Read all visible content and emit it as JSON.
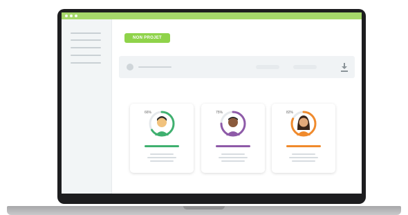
{
  "window": {
    "accent": "#a6d86a"
  },
  "main": {
    "new_project_label": "NON PROJET"
  },
  "icons": {
    "download": "download-icon"
  },
  "cards": [
    {
      "percent_label": "66%",
      "color": "#3fb06f",
      "progress": 0.66,
      "avatar": "man-green-shirt"
    },
    {
      "percent_label": "75%",
      "color": "#8e5aa8",
      "progress": 0.75,
      "avatar": "man-purple-shirt"
    },
    {
      "percent_label": "82%",
      "color": "#f08a2c",
      "progress": 0.82,
      "avatar": "woman-orange-shirt"
    }
  ]
}
